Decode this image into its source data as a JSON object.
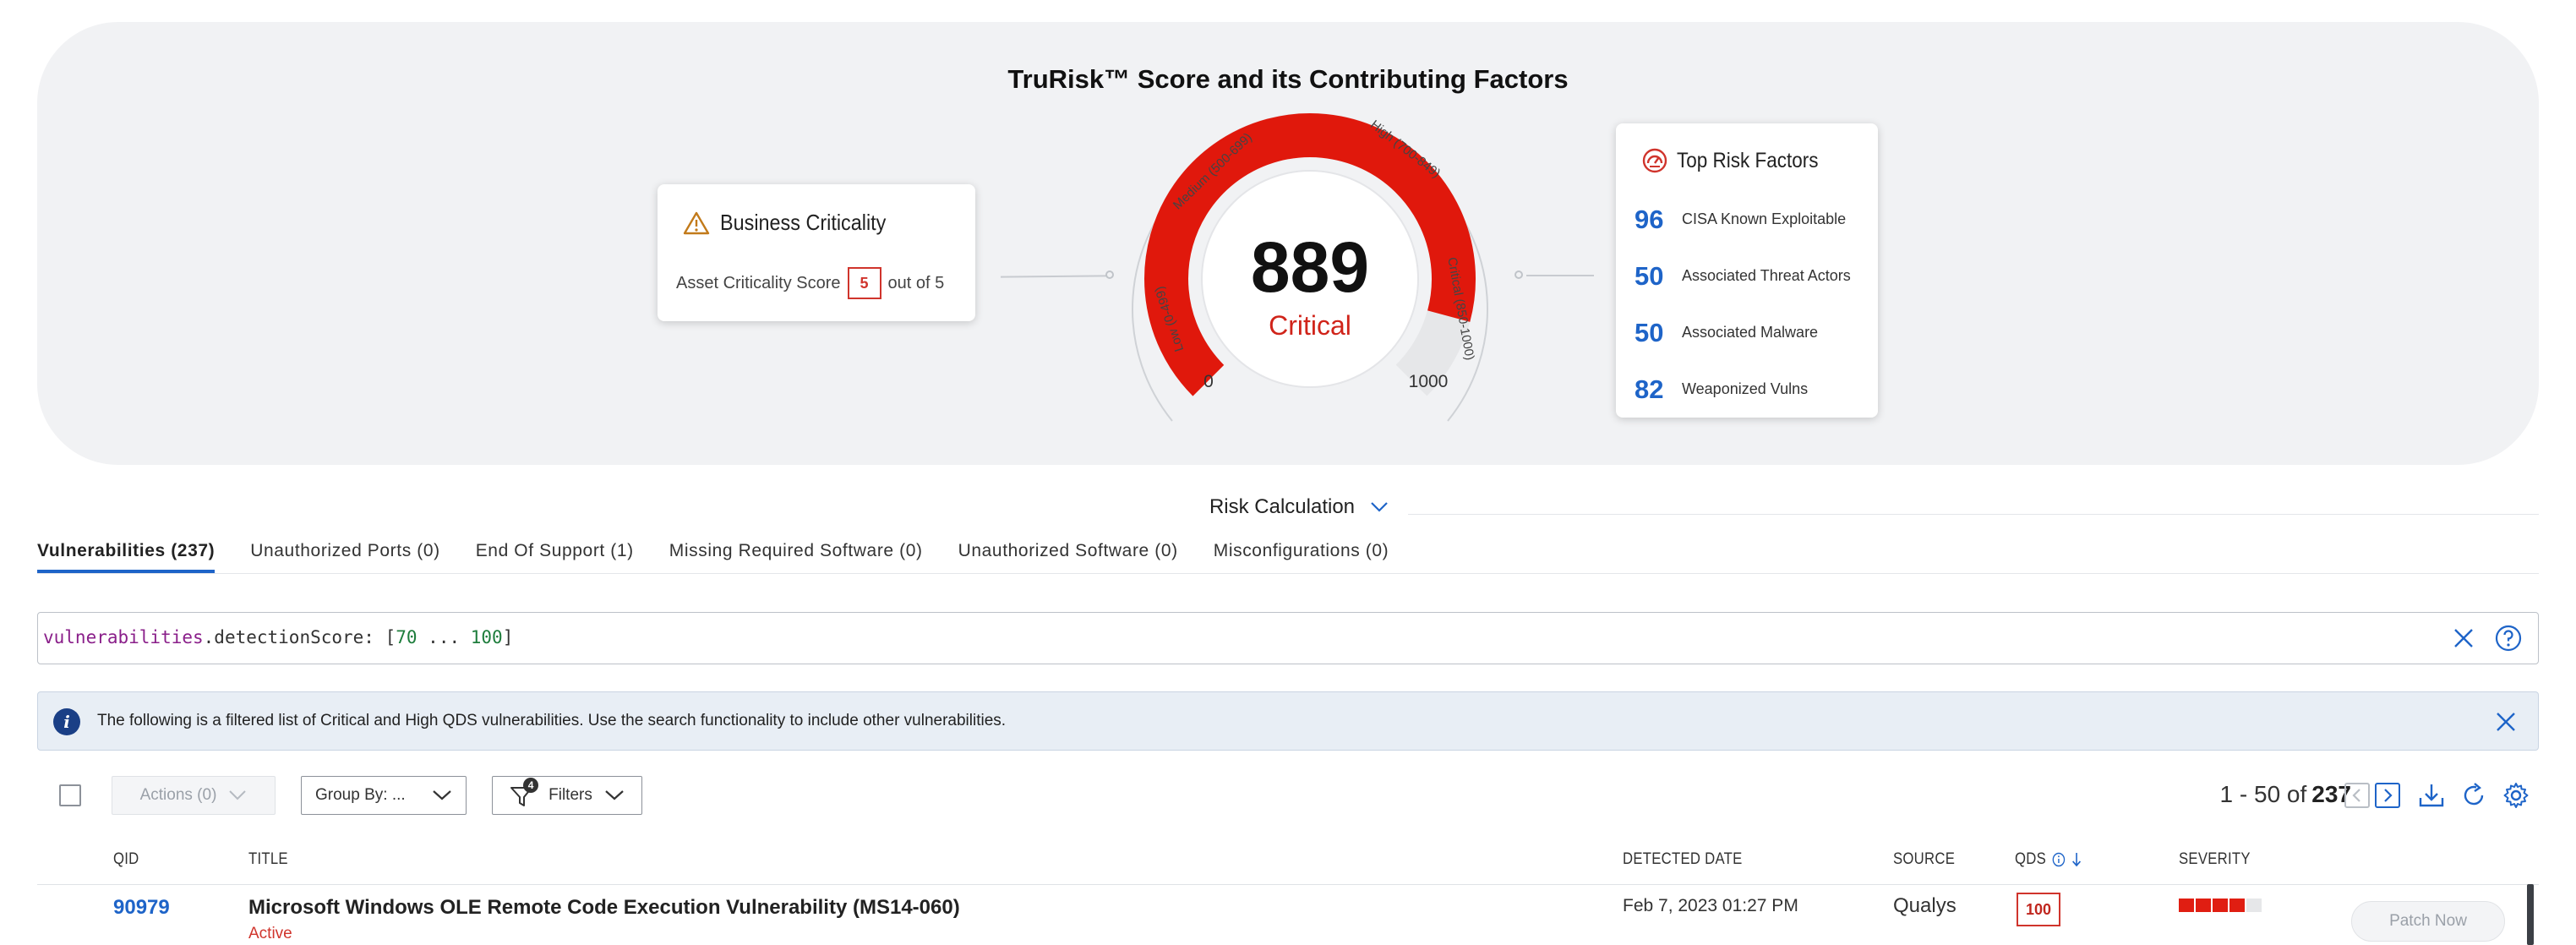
{
  "risk_panel": {
    "title": "TruRisk™ Score and its Contributing Factors",
    "business_criticality": {
      "title": "Business Criticality",
      "label": "Asset Criticality Score",
      "score": "5",
      "suffix": "out of 5"
    },
    "gauge": {
      "score": "889",
      "level": "Critical",
      "min_label": "0",
      "max_label": "1000",
      "score_fraction": 0.889,
      "bands": [
        "Low (0-499)",
        "Medium (500-699)",
        "High (700-849)",
        "Critical (850-1000)"
      ],
      "color": "#e0180c"
    },
    "top_risk_factors": {
      "title": "Top Risk Factors",
      "items": [
        {
          "value": "96",
          "label": "CISA Known Exploitable"
        },
        {
          "value": "50",
          "label": "Associated Threat Actors"
        },
        {
          "value": "50",
          "label": "Associated Malware"
        },
        {
          "value": "82",
          "label": "Weaponized Vulns"
        }
      ]
    }
  },
  "risk_calculation_label": "Risk Calculation",
  "tabs": [
    {
      "label": "Vulnerabilities (237)",
      "active": true
    },
    {
      "label": "Unauthorized Ports (0)",
      "active": false
    },
    {
      "label": "End Of Support (1)",
      "active": false
    },
    {
      "label": "Missing Required Software (0)",
      "active": false
    },
    {
      "label": "Unauthorized Software (0)",
      "active": false
    },
    {
      "label": "Misconfigurations (0)",
      "active": false
    }
  ],
  "search": {
    "field": "vulnerabilities",
    "subfield": ".detectionScore: [",
    "from": "70",
    "sep": " ... ",
    "to": "100",
    "close": "]"
  },
  "info_banner": {
    "text": "The following is a filtered list of Critical and High QDS vulnerabilities. Use the search functionality to include other vulnerabilities."
  },
  "toolbar": {
    "actions_label": "Actions (0)",
    "group_by_label": "Group By: ...",
    "filters_label": "Filters",
    "filters_count": "4",
    "pager_range": "1 - 50 of",
    "pager_total": "237"
  },
  "table": {
    "headers": {
      "qid": "QID",
      "title": "TITLE",
      "detected_date": "DETECTED DATE",
      "source": "SOURCE",
      "qds": "QDS",
      "severity": "SEVERITY"
    },
    "rows": [
      {
        "qid": "90979",
        "title": "Microsoft Windows OLE Remote Code Execution Vulnerability (MS14-060)",
        "status": "Active",
        "detected_date": "Feb 7, 2023 01:27 PM",
        "source": "Qualys",
        "qds": "100",
        "severity_level": 4,
        "severity_max": 5,
        "action": "Patch Now"
      }
    ]
  },
  "colors": {
    "accent": "#1e64c8",
    "critical": "#e0180c",
    "panel_bg": "#f1f2f4"
  }
}
